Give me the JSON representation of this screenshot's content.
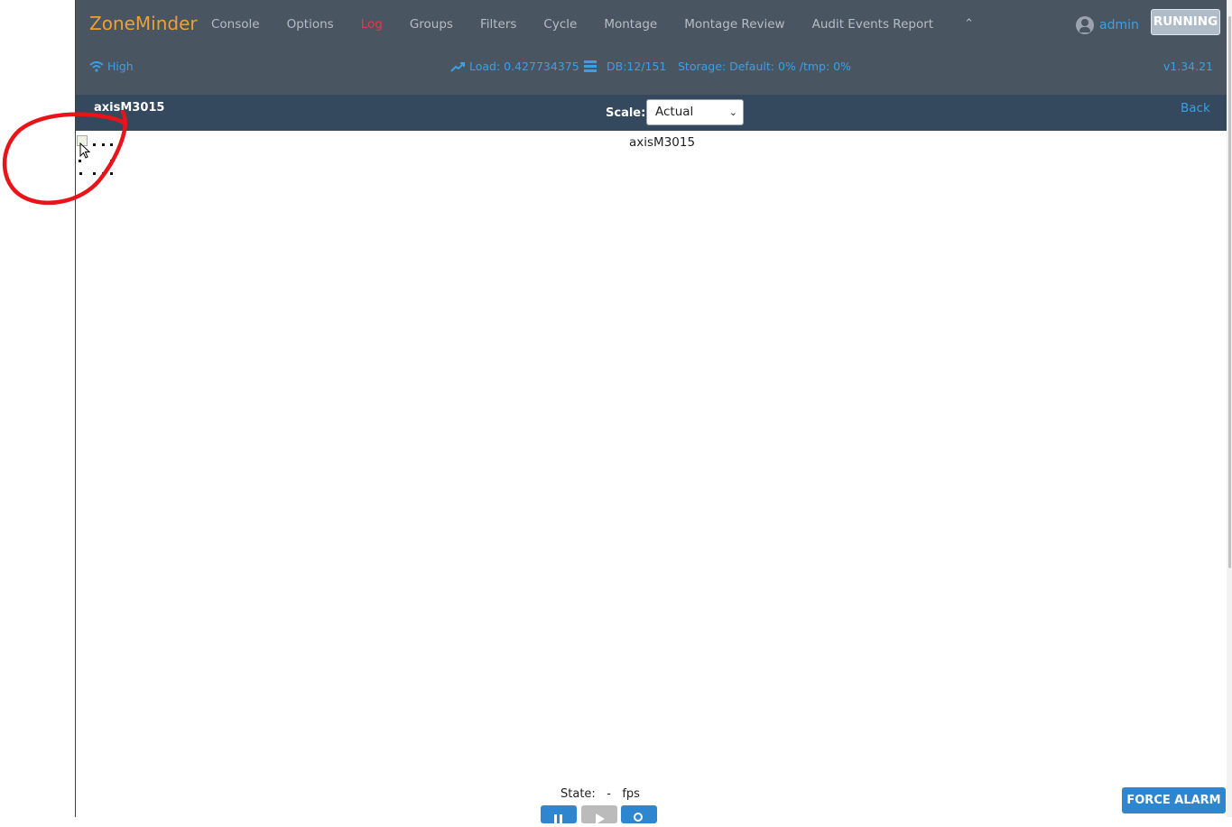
{
  "app": {
    "brand": "ZoneMinder"
  },
  "nav": {
    "items": [
      {
        "label": "Console",
        "active": false
      },
      {
        "label": "Options",
        "active": false
      },
      {
        "label": "Log",
        "active": true
      },
      {
        "label": "Groups",
        "active": false
      },
      {
        "label": "Filters",
        "active": false
      },
      {
        "label": "Cycle",
        "active": false
      },
      {
        "label": "Montage",
        "active": false
      },
      {
        "label": "Montage Review",
        "active": false
      },
      {
        "label": "Audit Events Report",
        "active": false
      }
    ],
    "collapse_icon": "chevron-up-icon",
    "user": "admin",
    "status_button": "RUNNING"
  },
  "statusbar": {
    "bandwidth": "High",
    "load": "Load: 0.427734375",
    "db": "DB:12/151",
    "storage": "Storage: Default: 0% /tmp: 0%",
    "version": "v1.34.21"
  },
  "header": {
    "monitor_name": "axisM3015",
    "scale_label": "Scale:",
    "scale_value": "Actual",
    "back_label": "Back"
  },
  "stream": {
    "title": "axisM3015",
    "state_label": "State:",
    "state_value": "-",
    "fps_label": "fps"
  },
  "controls": {
    "force_alarm_label": "FORCE ALARM"
  },
  "colors": {
    "navbar_bg": "#4a5562",
    "header_bg": "#34485e",
    "brand": "#f0a030",
    "link": "#3aa0e6",
    "active_menu": "#e8374a",
    "button_blue": "#2f86d0",
    "annotation_red": "#e8141a"
  }
}
